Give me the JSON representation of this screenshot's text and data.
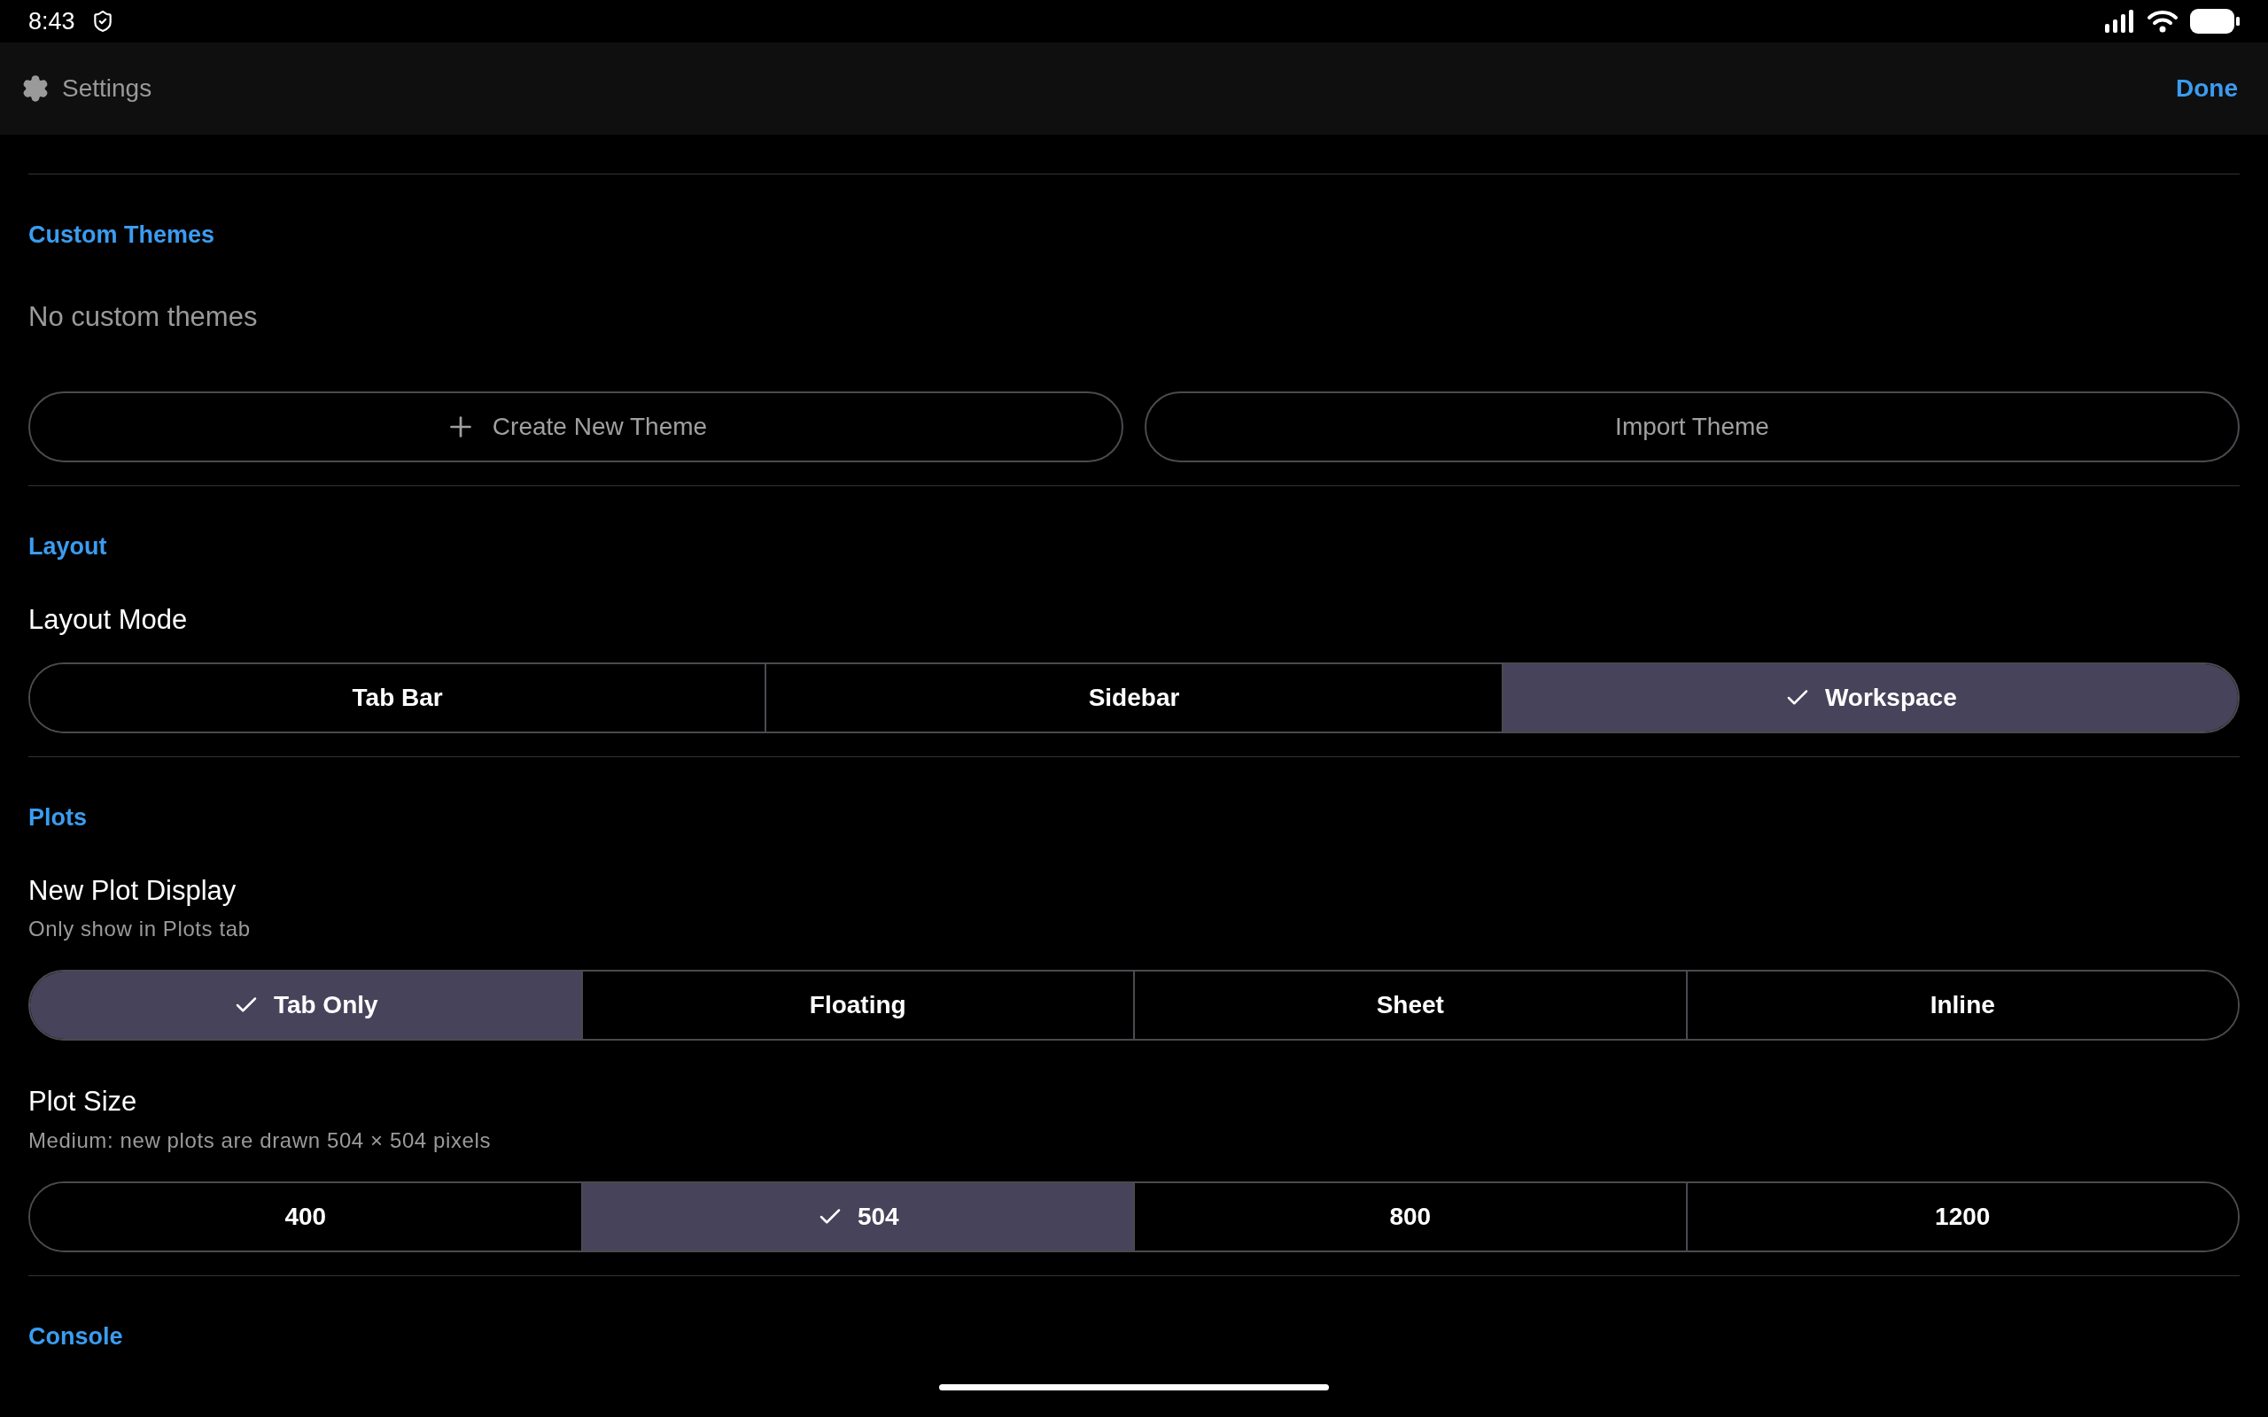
{
  "status_bar": {
    "time": "8:43"
  },
  "header": {
    "title": "Settings",
    "action": "Done"
  },
  "sections": [
    {
      "title": "Custom Themes",
      "items": [
        {
          "kind": "note",
          "text": "No custom themes"
        },
        {
          "kind": "buttons",
          "buttons": [
            {
              "label": "Create New Theme",
              "kind": "add"
            },
            {
              "label": "Import Theme",
              "kind": "plain"
            }
          ]
        }
      ]
    },
    {
      "title": "Layout",
      "items": [
        {
          "kind": "segmented",
          "label": "Layout Mode",
          "options": [
            {
              "label": "Tab Bar",
              "selected": false
            },
            {
              "label": "Sidebar",
              "selected": false
            },
            {
              "label": "Workspace",
              "selected": true
            }
          ]
        }
      ]
    },
    {
      "title": "Plots",
      "items": [
        {
          "kind": "segmented",
          "label": "New Plot Display",
          "description": "Only show in Plots tab",
          "options": [
            {
              "label": "Tab Only",
              "selected": true
            },
            {
              "label": "Floating",
              "selected": false
            },
            {
              "label": "Sheet",
              "selected": false
            },
            {
              "label": "Inline",
              "selected": false
            }
          ]
        },
        {
          "kind": "segmented",
          "label": "Plot Size",
          "description": "Medium: new plots are drawn 504 × 504 pixels",
          "options": [
            {
              "label": "400",
              "selected": false
            },
            {
              "label": "504",
              "selected": true
            },
            {
              "label": "800",
              "selected": false
            },
            {
              "label": "1200",
              "selected": false
            }
          ]
        }
      ]
    },
    {
      "title": "Console"
    }
  ]
}
